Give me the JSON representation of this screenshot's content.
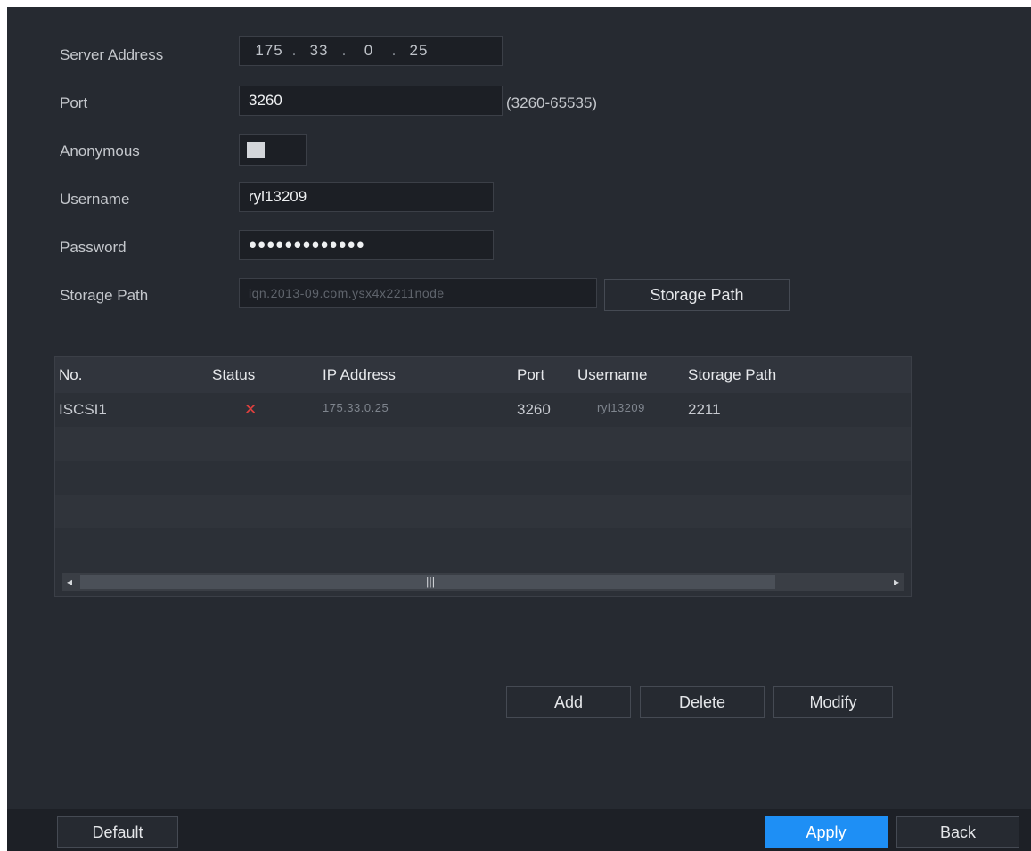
{
  "form": {
    "server_address_label": "Server Address",
    "server_address": [
      "175",
      "33",
      "0",
      "25"
    ],
    "port_label": "Port",
    "port_value": "3260",
    "port_range": "(3260-65535)",
    "anonymous_label": "Anonymous",
    "anonymous_on": false,
    "username_label": "Username",
    "username_value": "ryl13209",
    "password_label": "Password",
    "password_value": "●●●●●●●●●●●●●",
    "storage_path_label": "Storage Path",
    "storage_path_value": "iqn.2013-09.com.ysx4x2211node",
    "storage_path_button": "Storage Path"
  },
  "table": {
    "columns": [
      "No.",
      "Status",
      "IP Address",
      "Port",
      "Username",
      "Storage Path"
    ],
    "rows": [
      {
        "no": "ISCSI1",
        "status": "✕",
        "ip": "175.33.0.25",
        "port": "3260",
        "username": "ryl13209",
        "storage_path": "2211"
      }
    ]
  },
  "actions": {
    "add": "Add",
    "delete": "Delete",
    "modify": "Modify"
  },
  "footer": {
    "default": "Default",
    "apply": "Apply",
    "back": "Back"
  },
  "colors": {
    "background": "#262a31",
    "accent": "#1e8ff5",
    "status_error": "#e0403e"
  },
  "icons": {
    "scroll_left": "arrow-left-icon",
    "scroll_right": "arrow-right-icon",
    "scroll_grip": "grip-icon",
    "status": "error-x-icon"
  }
}
